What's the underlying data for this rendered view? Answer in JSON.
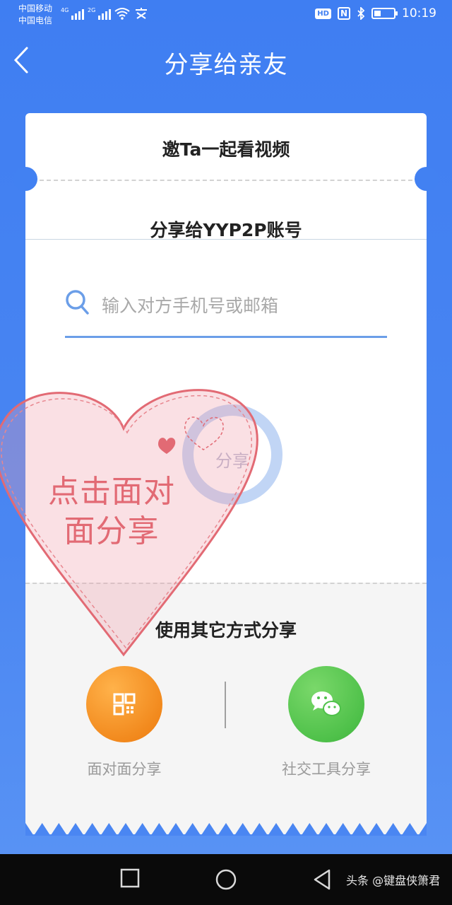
{
  "status_bar": {
    "carrier_1": "中国移动",
    "carrier_2": "中国电信",
    "net_1": "4G",
    "net_2": "2G",
    "hd_label": "HD",
    "nfc_label": "N",
    "time": "10:19",
    "icons": [
      "signal-icon",
      "wifi-icon",
      "nfc-icon",
      "bluetooth-icon",
      "battery-icon"
    ]
  },
  "header": {
    "title": "分享给亲友",
    "back_icon": "chevron-left-icon"
  },
  "card": {
    "invite_title": "邀Ta一起看视频",
    "share_account_title": "分享给YYP2P账号",
    "search": {
      "placeholder": "输入对方手机号或邮箱",
      "value": ""
    },
    "share_button_label": "分享",
    "other_methods_title": "使用其它方式分享",
    "options": [
      {
        "label": "面对面分享",
        "icon": "qr-code-icon",
        "color": "#f28a1e"
      },
      {
        "label": "社交工具分享",
        "icon": "wechat-icon",
        "color": "#4fc14a"
      }
    ]
  },
  "sticker": {
    "line_1": "点击面对",
    "line_2": "面分享",
    "color": "#e26a74"
  },
  "nav_bar": {
    "buttons": [
      "recents-square-icon",
      "home-circle-icon",
      "back-triangle-icon"
    ],
    "watermark": "头条 @键盘侠箫君"
  },
  "colors": {
    "background": "#4281f2",
    "search_underline": "#6b9ee8"
  }
}
